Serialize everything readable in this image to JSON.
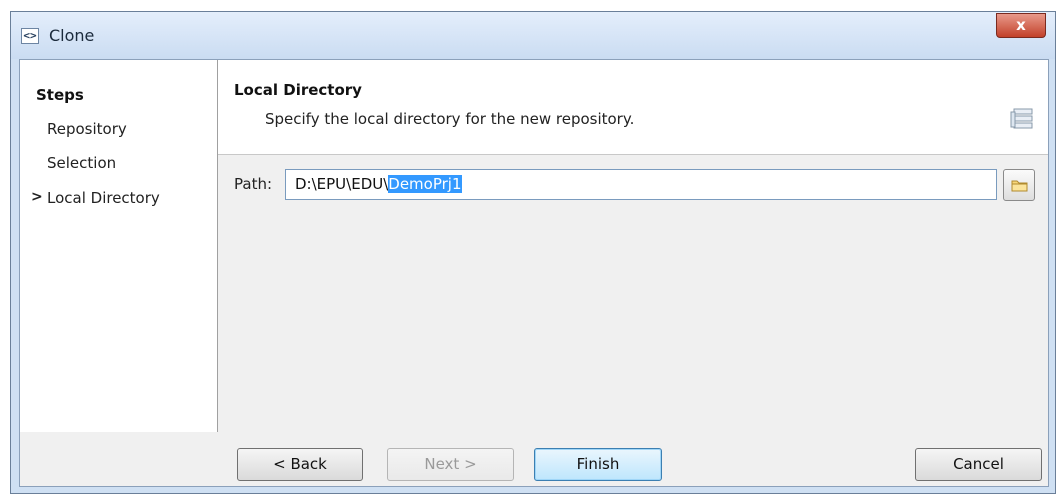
{
  "window": {
    "title": "Clone",
    "close_label": "x"
  },
  "steps": {
    "title": "Steps",
    "items": [
      {
        "label": "Repository",
        "current": false
      },
      {
        "label": "Selection",
        "current": false
      },
      {
        "label": "Local Directory",
        "current": true
      }
    ],
    "current_marker": ">"
  },
  "page": {
    "title": "Local Directory",
    "description": "Specify the local directory for the new repository."
  },
  "path": {
    "label": "Path:",
    "value_prefix": "D:\\EPU\\EDU\\",
    "value_selected": "DemoPrj1"
  },
  "buttons": {
    "back": "< Back",
    "next": "Next >",
    "finish": "Finish",
    "cancel": "Cancel"
  },
  "colors": {
    "selection": "#3399ff",
    "title_bar": "#cfe0f3",
    "close": "#c2412a"
  }
}
